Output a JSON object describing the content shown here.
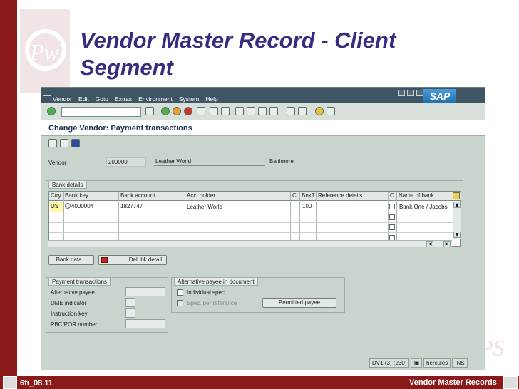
{
  "slide": {
    "title_line1": "Vendor Master Record - Client",
    "title_line2": "Segment",
    "footer_left": "6fi_08.11",
    "footer_right": "Vendor Master Records",
    "brand_color": "#8a1a1a",
    "title_color": "#3a2b80"
  },
  "menu": [
    "Vendor",
    "Edit",
    "Goto",
    "Extras",
    "Environment",
    "System",
    "Help"
  ],
  "sap_logo": "SAP",
  "screen_title": "Change Vendor: Payment transactions",
  "vendor": {
    "label": "Vendor",
    "number": "200000",
    "name": "Leather World",
    "city": "Baltimore"
  },
  "bank_details": {
    "title": "Bank details",
    "columns": [
      "Ctry",
      "Bank key",
      "Bank account",
      "Acct holder",
      "C",
      "BnkT",
      "Reference details",
      "C",
      "Name of bank"
    ],
    "rows": [
      {
        "ctry": "US",
        "bank_key": "4000004",
        "bank_account": "1827747",
        "acct_holder": "Leather World",
        "bnkt": "100",
        "name_of_bank": "Bank One / Jacobs"
      }
    ],
    "buttons": {
      "bank_data": "Bank data...",
      "del_detail": "Del. bk detail"
    }
  },
  "payment_transactions": {
    "title": "Payment transactions",
    "fields": [
      "Alternative payee",
      "DME indicator",
      "Instruction key",
      "PBC/POR number"
    ]
  },
  "alt_payee": {
    "title": "Alternative payee in document",
    "individual_spec": "Individual spec.",
    "spec_per_reference": "Spec. per reference",
    "permitted_payee_button": "Permitted payee"
  },
  "status": {
    "system": "DV1 (3) (230)",
    "server": "hercules",
    "mode": "INS"
  }
}
